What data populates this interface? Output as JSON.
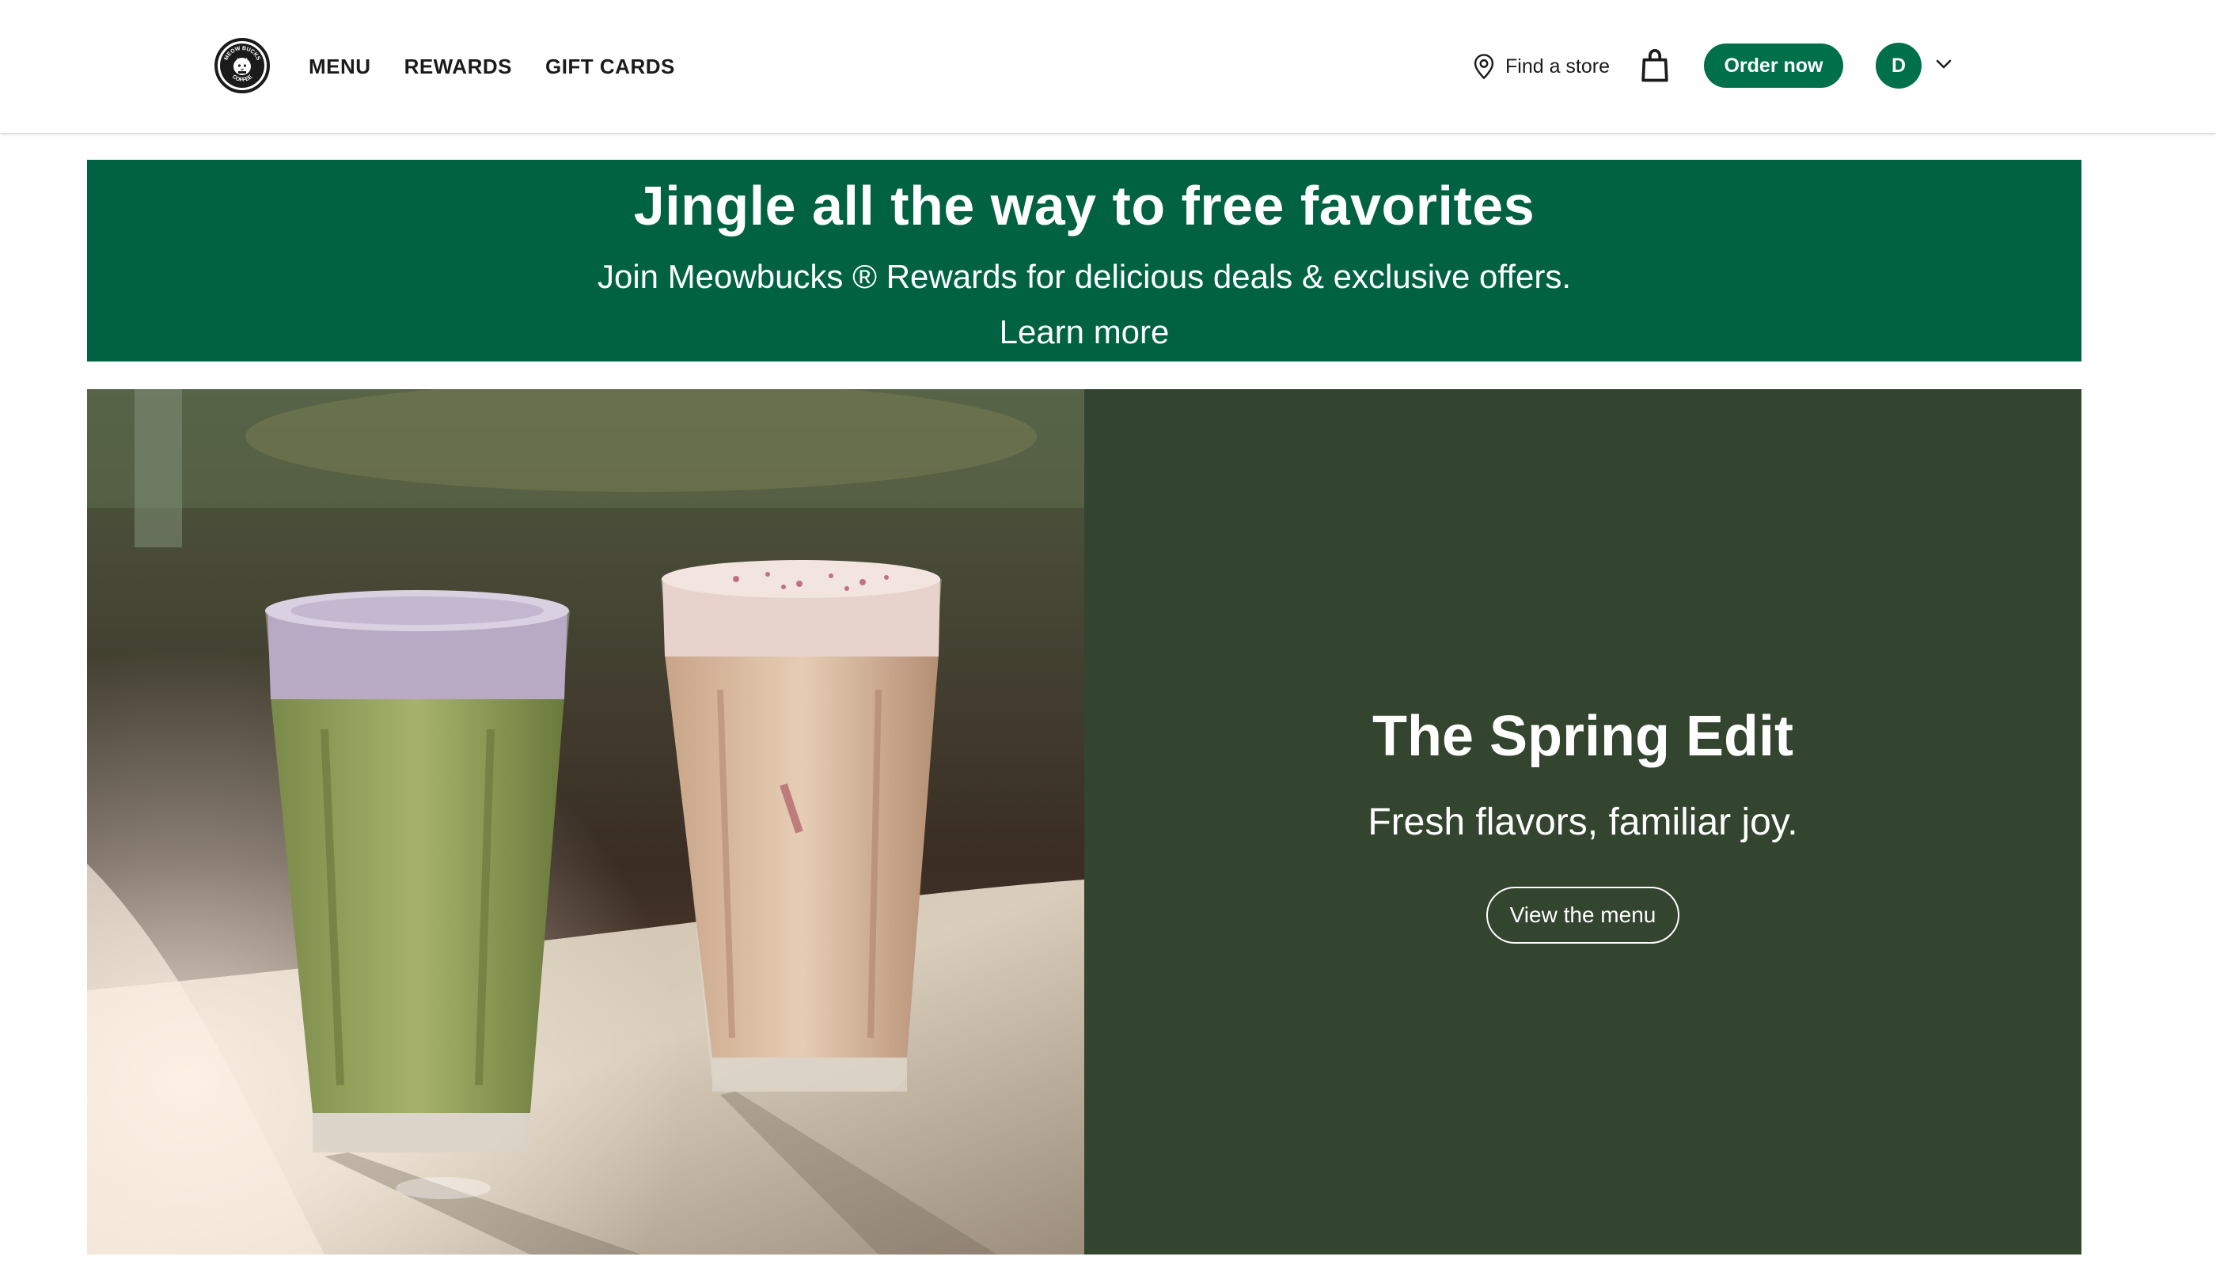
{
  "brand": {
    "logo_text": "MEOW BUCKS COFFEE",
    "accent_color": "#00704a",
    "promo_color": "#006241",
    "feature_panel_color": "#33442f"
  },
  "nav": {
    "items": [
      "MENU",
      "REWARDS",
      "GIFT CARDS"
    ],
    "find_store": "Find a store",
    "find_store_icon": "map-pin-icon",
    "bag_icon": "shopping-bag-icon",
    "order_button": "Order now",
    "avatar_initial": "D",
    "account_menu_icon": "chevron-down-icon"
  },
  "promo": {
    "title": "Jingle all the way to free favorites",
    "subtitle": "Join Meowbucks ® Rewards for delicious deals & exclusive offers.",
    "link": "Learn more"
  },
  "feature": {
    "image_alt": "Two iced lattes: a green matcha drink with lavender cold foam and a pink drink topped with petals",
    "title": "The Spring Edit",
    "subtitle": "Fresh flavors, familiar joy.",
    "button": "View the menu"
  }
}
